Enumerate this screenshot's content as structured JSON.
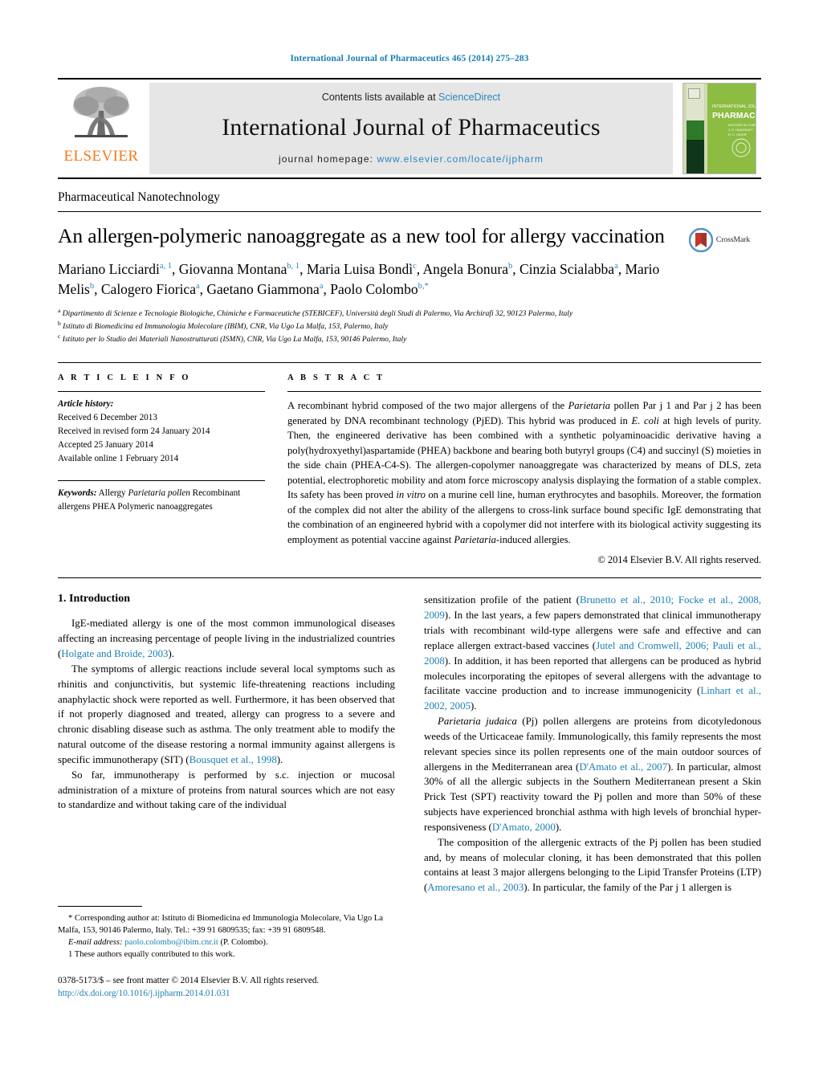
{
  "running_head": "International Journal of Pharmaceutics 465 (2014) 275–283",
  "masthead": {
    "publisher_logo_text": "ELSEVIER",
    "contents_prefix": "Contents lists available at ",
    "contents_link": "ScienceDirect",
    "journal_title": "International Journal of Pharmaceutics",
    "homepage_prefix": "journal homepage: ",
    "homepage_url": "www.elsevier.com/locate/ijpharm",
    "cover_title_small": "INTERNATIONAL JOURNAL OF",
    "cover_title_big": "PHARMACEUTICS",
    "cover_color": "#86b93b"
  },
  "section_label": "Pharmaceutical Nanotechnology",
  "crossmark": {
    "label": "CrossMark",
    "color": "#c0392b",
    "ring_color": "#3c8dbc"
  },
  "article": {
    "title": "An allergen-polymeric nanoaggregate as a new tool for allergy vaccination",
    "authors_html": "Mariano Licciardi<sup>a, 1</sup>, Giovanna Montana<sup>b, 1</sup>, Maria Luisa Bondì<sup>c</sup>, Angela Bonura<sup>b</sup>, Cinzia Scialabba<sup>a</sup>, Mario Melis<sup>b</sup>, Calogero Fiorica<sup>a</sup>, Gaetano Giammona<sup>a</sup>, Paolo Colombo<sup>b,*</sup>",
    "affiliations": [
      "Dipartimento di Scienze e Tecnologie Biologiche, Chimiche e Farmaceutiche (STEBICEF), Università degli Studi di Palermo, Via Archirafi 32, 90123 Palermo, Italy",
      "Istituto di Biomedicina ed Immunologia Molecolare (IBIM), CNR, Via Ugo La Malfa, 153, Palermo, Italy",
      "Istituto per lo Studio dei Materiali Nanostrutturati (ISMN), CNR, Via Ugo La Malfa, 153, 90146 Palermo, Italy"
    ],
    "affiliation_marks": [
      "a",
      "b",
      "c"
    ]
  },
  "article_info": {
    "heading": "A R T I C L E    I N F O",
    "history_label": "Article history:",
    "history": [
      "Received 6 December 2013",
      "Received in revised form 24 January 2014",
      "Accepted 25 January 2014",
      "Available online 1 February 2014"
    ],
    "keywords_label": "Keywords:",
    "keywords": [
      "Allergy",
      "Parietaria pollen",
      "Recombinant allergens",
      "PHEA",
      "Polymeric nanoaggregates"
    ]
  },
  "abstract": {
    "heading": "A B S T R A C T",
    "text_html": "A recombinant hybrid composed of the two major allergens of the <i>Parietaria</i> pollen Par j 1 and Par j 2 has been generated by DNA recombinant technology (PjED). This hybrid was produced in <i>E. coli</i> at high levels of purity. Then, the engineered derivative has been combined with a synthetic polyaminoacidic derivative having a poly(hydroxyethyl)aspartamide (PHEA) backbone and bearing both butyryl groups (C4) and succinyl (S) moieties in the side chain (PHEA-C4-S). The allergen-copolymer nanoaggregate was characterized by means of DLS, zeta potential, electrophoretic mobility and atom force microscopy analysis displaying the formation of a stable complex. Its safety has been proved <i>in vitro</i> on a murine cell line, human erythrocytes and basophils. Moreover, the formation of the complex did not alter the ability of the allergens to cross-link surface bound specific IgE demonstrating that the combination of an engineered hybrid with a copolymer did not interfere with its biological activity suggesting its employment as potential vaccine against <i>Parietaria</i>-induced allergies.",
    "copyright": "© 2014 Elsevier B.V. All rights reserved."
  },
  "body": {
    "intro_heading": "1.  Introduction",
    "left_paragraphs_html": [
      "IgE-mediated allergy is one of the most common immunological diseases affecting an increasing percentage of people living in the industrialized countries (<span class=\"ref\">Holgate and Broide, 2003</span>).",
      "The symptoms of allergic reactions include several local symptoms such as rhinitis and conjunctivitis, but systemic life-threatening reactions including anaphylactic shock were reported as well. Furthermore, it has been observed that if not properly diagnosed and treated, allergy can progress to a severe and chronic disabling disease such as asthma. The only treatment able to modify the natural outcome of the disease restoring a normal immunity against allergens is specific immunotherapy (SIT) (<span class=\"ref\">Bousquet et al., 1998</span>).",
      "So far, immunotherapy is performed by s.c. injection or mucosal administration of a mixture of proteins from natural sources which are not easy to standardize and without taking care of the individual"
    ],
    "right_paragraphs_html": [
      "sensitization profile of the patient (<span class=\"ref\">Brunetto et al., 2010; Focke et al., 2008, 2009</span>). In the last years, a few papers demonstrated that clinical immunotherapy trials with recombinant wild-type allergens were safe and effective and can replace allergen extract-based vaccines (<span class=\"ref\">Jutel and Cromwell, 2006; Pauli et al., 2008</span>). In addition, it has been reported that allergens can be produced as hybrid molecules incorporating the epitopes of several allergens with the advantage to facilitate vaccine production and to increase immunogenicity (<span class=\"ref\">Linhart et al., 2002, 2005</span>).",
      "<i>Parietaria judaica</i> (Pj) pollen allergens are proteins from dicotyledonous weeds of the Urticaceae family. Immunologically, this family represents the most relevant species since its pollen represents one of the main outdoor sources of allergens in the Mediterranean area (<span class=\"ref\">D'Amato et al., 2007</span>). In particular, almost 30% of all the allergic subjects in the Southern Mediterranean present a Skin Prick Test (SPT) reactivity toward the Pj pollen and more than 50% of these subjects have experienced bronchial asthma with high levels of bronchial hyper-responsiveness (<span class=\"ref\">D'Amato, 2000</span>).",
      "The composition of the allergenic extracts of the Pj pollen has been studied and, by means of molecular cloning, it has been demonstrated that this pollen contains at least 3 major allergens belonging to the Lipid Transfer Proteins (LTP) (<span class=\"ref\">Amoresano et al., 2003</span>). In particular, the family of the Par j 1 allergen is"
    ]
  },
  "footnotes": {
    "corresponding_html": "* Corresponding author at: Istituto di Biomedicina ed Immunologia Molecolare, Via Ugo La Malfa, 153, 90146 Palermo, Italy. Tel.: +39 91 6809535; fax: +39 91 6809548.",
    "email_label": "E-mail address:",
    "email": "paolo.colombo@ibim.cnr.it",
    "email_suffix": " (P. Colombo).",
    "equal_contrib": "1  These authors equally contributed to this work.",
    "imprint_line": "0378-5173/$ – see front matter © 2014 Elsevier B.V. All rights reserved.",
    "doi": "http://dx.doi.org/10.1016/j.ijpharm.2014.01.031"
  }
}
